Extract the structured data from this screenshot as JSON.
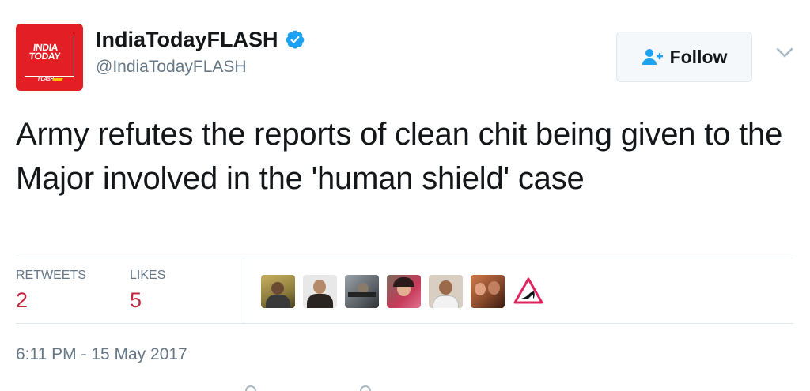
{
  "profile": {
    "display_name": "IndiaTodayFLASH",
    "handle": "@IndiaTodayFLASH",
    "verified": true,
    "avatar_text": "INDIA TODAY",
    "avatar_subtext": "FLASH",
    "brand_color": "#e31e24"
  },
  "follow": {
    "label": "Follow",
    "icon": "add-user-icon",
    "accent_color": "#1da1f2"
  },
  "tweet": {
    "text": "Army refutes the reports of clean chit being given to the Major involved in the 'human shield' case",
    "timestamp": "6:11 PM - 15 May 2017"
  },
  "stats": {
    "retweets_label": "RETWEETS",
    "retweets_count": "2",
    "likes_label": "LIKES",
    "likes_count": "5",
    "count_color": "#c5283d"
  },
  "likers": {
    "avatars": [
      {
        "name": "liker-avatar-1",
        "color": "#8a7a3c"
      },
      {
        "name": "liker-avatar-2",
        "color": "#3a3530"
      },
      {
        "name": "liker-avatar-3",
        "color": "#6b7278"
      },
      {
        "name": "liker-avatar-4",
        "color": "#c73a5a"
      },
      {
        "name": "liker-avatar-5",
        "color": "#c9b9a3"
      },
      {
        "name": "liker-avatar-6",
        "color": "#8a4a2c"
      }
    ],
    "trailing_icon": "high-heel-warning-icon"
  }
}
